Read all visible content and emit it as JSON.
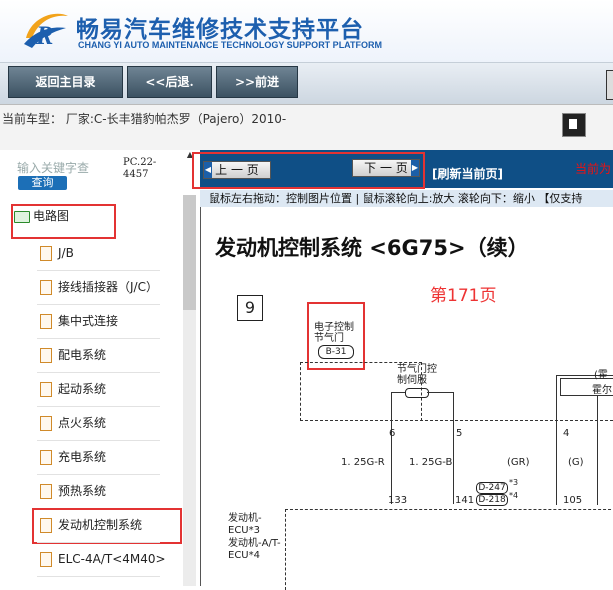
{
  "header": {
    "title": "畅易汽车维修技术支持平台",
    "subtitle": "CHANG YI AUTO MAINTENANCE TECHNOLOGY SUPPORT PLATFORM",
    "logo_letter": "R"
  },
  "nav": {
    "home": "返回主目录",
    "back": "<<后退.",
    "forward": ">>前进"
  },
  "car": {
    "label": "当前车型： 厂家:C-长丰猎豹帕杰罗（Pajero）2010-"
  },
  "sidebar": {
    "search_placeholder": "输入关键字查",
    "search_button": "查询",
    "code": "PC.22-4457",
    "root_label": "电路图",
    "items": [
      {
        "label": "J/B"
      },
      {
        "label": "接线插接器（J/C）"
      },
      {
        "label": "集中式连接"
      },
      {
        "label": "配电系统"
      },
      {
        "label": "起动系统"
      },
      {
        "label": "点火系统"
      },
      {
        "label": "充电系统"
      },
      {
        "label": "预热系统"
      },
      {
        "label": "发动机控制系统"
      },
      {
        "label": "ELC-4A/T<4M40>"
      }
    ]
  },
  "toolbar": {
    "prev": "上 一 页",
    "next": "下 一 页",
    "refresh": "[刷新当前页]",
    "current_label": "当前为",
    "prev_arrow": "◀",
    "next_arrow": "▶"
  },
  "hint": "鼠标左右拖动：控制图片位置 | 鼠标滚轮向上:放大  滚轮向下：缩小 【仅支持",
  "diagram": {
    "title": "发动机控制系统 <6G75>（续）",
    "page_number": "第171页",
    "box_number": "9",
    "throttle_label": "电子控制节气门",
    "throttle_connector": "B-31",
    "servo_label": "节气门控制伺服",
    "pins": [
      "6",
      "5",
      "4"
    ],
    "wire_a": "1. 25G-R",
    "wire_b": "1. 25G-B",
    "wire_c": "(GR)",
    "wire_d": "(G)",
    "conn_a": "D-247",
    "conn_b": "D-218",
    "star3": "*3",
    "star4": "*4",
    "pin_133": "133",
    "pin_141": "141",
    "pin_105": "105",
    "ecu_a": "发动机-ECU*3",
    "ecu_b": "发动机-A/T-ECU*4",
    "right_cut": "霍尔",
    "right_cut_top": "(霍"
  }
}
